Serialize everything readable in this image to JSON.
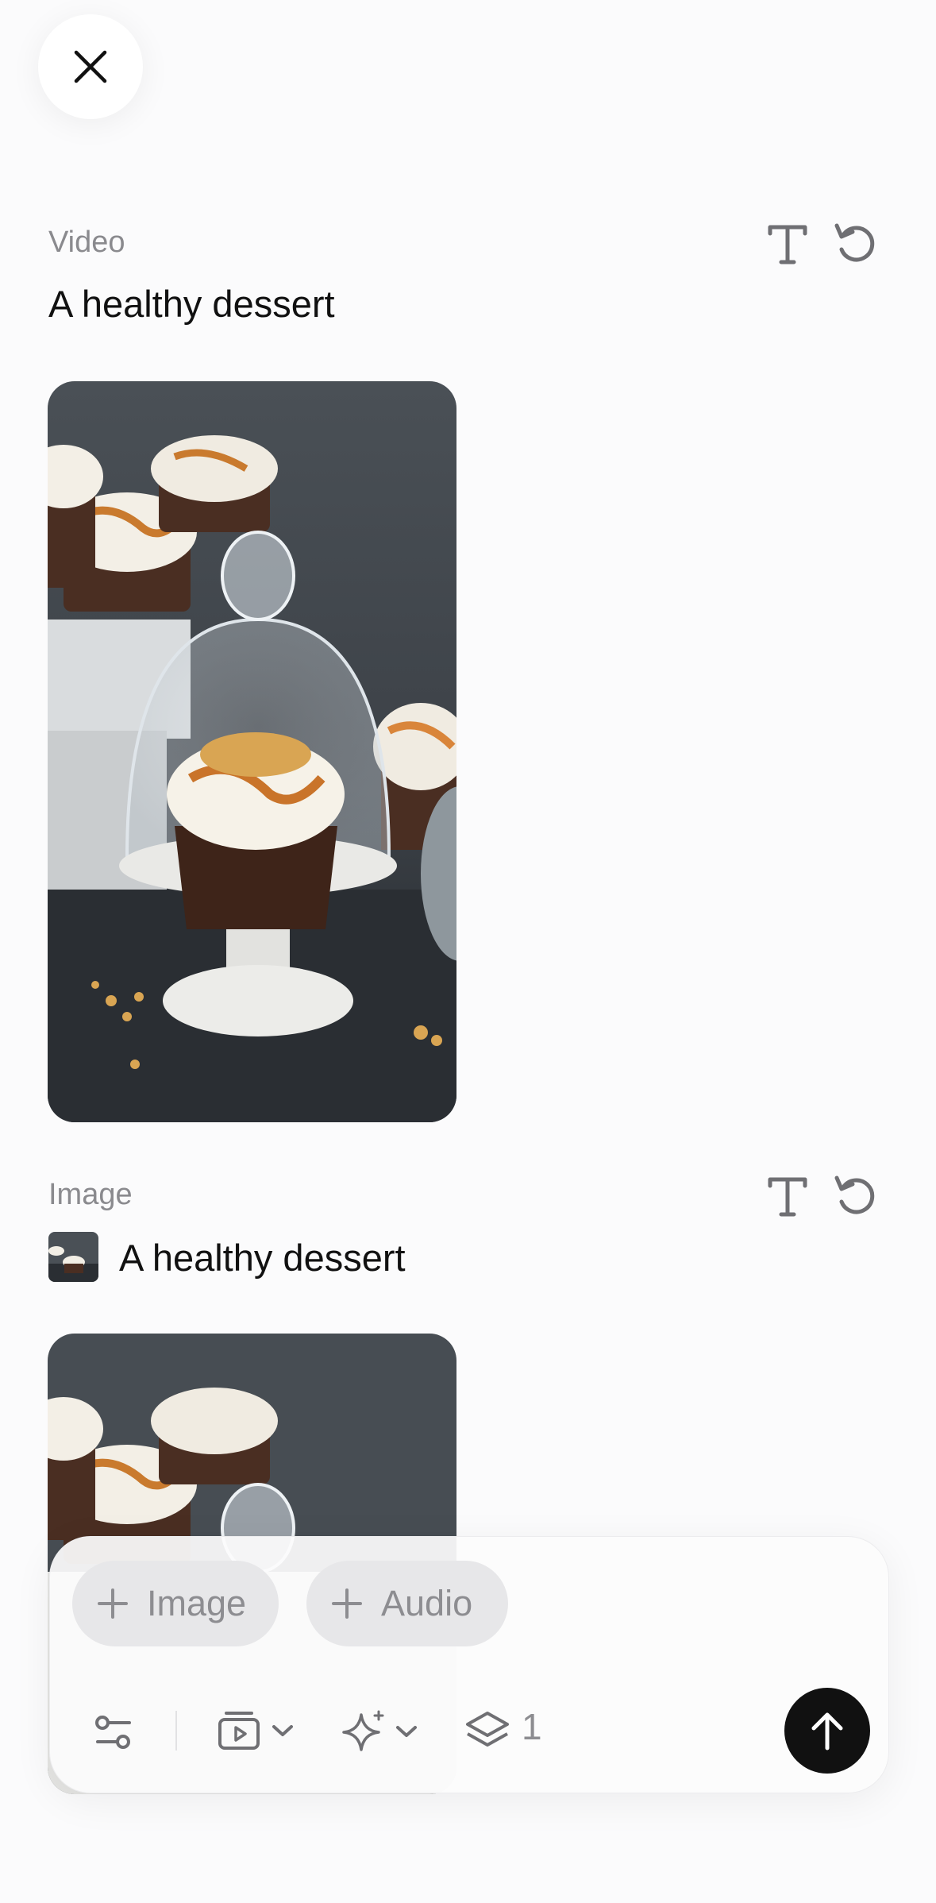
{
  "header": {
    "close_icon": "close-icon"
  },
  "sections": [
    {
      "label": "Video",
      "prompt": "A healthy dessert",
      "tools": [
        "text-icon",
        "undo-icon"
      ]
    },
    {
      "label": "Image",
      "prompt": "A healthy dessert",
      "tools": [
        "text-icon",
        "undo-icon"
      ]
    }
  ],
  "composer": {
    "chips": [
      {
        "label": "Image",
        "icon": "plus-icon"
      },
      {
        "label": "Audio",
        "icon": "plus-icon"
      }
    ],
    "toolbar": {
      "settings_icon": "sliders-icon",
      "format_icon": "video-format-icon",
      "style_icon": "sparkle-icon",
      "count_icon": "layers-icon",
      "count": "1",
      "send_icon": "arrow-up-icon"
    }
  },
  "colors": {
    "background": "#fbfbfc",
    "send": "#111111",
    "chip": "#e7e7e9",
    "muted_text": "#8a8a8e"
  }
}
